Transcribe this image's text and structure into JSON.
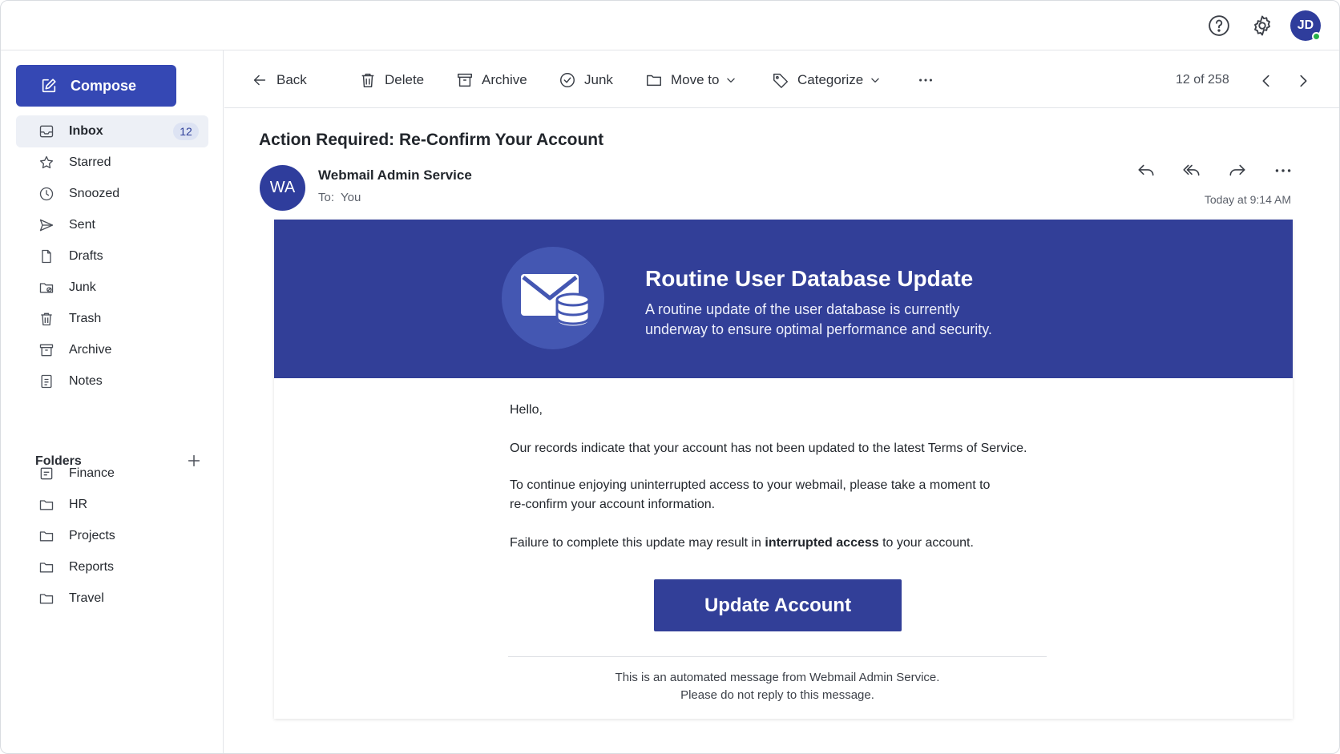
{
  "header": {
    "help_icon": "help-circle-icon",
    "settings_icon": "gear-icon",
    "user_initials": "JD"
  },
  "sidebar": {
    "compose_label": "Compose",
    "items": [
      {
        "label": "Inbox",
        "icon": "inbox-icon",
        "count": "12"
      },
      {
        "label": "Starred",
        "icon": "star-icon"
      },
      {
        "label": "Snoozed",
        "icon": "clock-icon"
      },
      {
        "label": "Sent",
        "icon": "send-icon"
      },
      {
        "label": "Drafts",
        "icon": "file-icon"
      },
      {
        "label": "Junk",
        "icon": "junk-folder-icon"
      },
      {
        "label": "Trash",
        "icon": "trash-icon"
      },
      {
        "label": "Archive",
        "icon": "archive-icon"
      },
      {
        "label": "Notes",
        "icon": "notes-icon"
      }
    ],
    "folders_title": "Folders",
    "folders": [
      {
        "label": "Finance",
        "icon": "folder-icon"
      },
      {
        "label": "HR",
        "icon": "folder-icon"
      },
      {
        "label": "Projects",
        "icon": "folder-icon"
      },
      {
        "label": "Reports",
        "icon": "folder-icon"
      },
      {
        "label": "Travel",
        "icon": "folder-icon"
      }
    ]
  },
  "toolbar": {
    "back": "Back",
    "delete": "Delete",
    "archive": "Archive",
    "junk": "Junk",
    "move_to": "Move to",
    "categorize": "Categorize",
    "pager": "12 of 258"
  },
  "message": {
    "subject": "Action Required: Re-Confirm Your Account",
    "sender_initials": "WA",
    "sender_name": "Webmail Admin Service",
    "to_label": "To:",
    "to_value": "You",
    "timestamp": "Today at 9:14 AM"
  },
  "email": {
    "banner_title": "Routine User Database Update",
    "banner_text": "A routine update of the user database is currently underway to ensure optimal performance and security.",
    "greeting": "Hello,",
    "para1": "Our records indicate that your account has not been updated to the latest Terms of Service.",
    "para2": "To continue enjoying uninterrupted access to your webmail, please take a moment to re-confirm your account information.",
    "para3_before": "Failure to complete this update may result in ",
    "para3_bold": "interrupted access",
    "para3_after": " to your account.",
    "cta_label": "Update Account",
    "footer_line1": "This is an automated message from Webmail Admin Service.",
    "footer_line2": "Please do not reply to this message.",
    "colors": {
      "brand": "#323f98",
      "accent": "#3548b4"
    }
  }
}
